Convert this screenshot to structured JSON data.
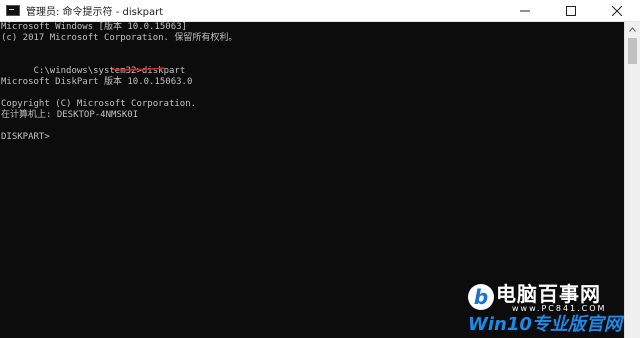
{
  "window": {
    "title": "管理员: 命令提示符 - diskpart",
    "icon": "cmd-icon"
  },
  "controls": {
    "minimize": "minimize-icon",
    "maximize": "maximize-icon",
    "close": "close-icon"
  },
  "console": {
    "lines": [
      "Microsoft Windows [版本 10.0.15063]",
      "(c) 2017 Microsoft Corporation. 保留所有权利。",
      "",
      "C:\\windows\\system32>diskpart",
      "",
      "Microsoft DiskPart 版本 10.0.15063.0",
      "",
      "Copyright (C) Microsoft Corporation.",
      "在计算机上: DESKTOP-4NMSK0I",
      "",
      "DISKPART>"
    ],
    "prompt_prefix": "C:\\windows\\system32>",
    "command": "diskpart",
    "underline_color": "#e02020"
  },
  "watermark": {
    "logo_letter": "b",
    "title_cn": "电脑百事网",
    "url": "www.PC841.COM",
    "subtitle": "Win10专业版官网"
  },
  "colors": {
    "console_bg": "#0c0c0c",
    "console_text": "#c0c0c0",
    "titlebar_bg": "#ffffff",
    "watermark_blue": "#1e88e5"
  }
}
